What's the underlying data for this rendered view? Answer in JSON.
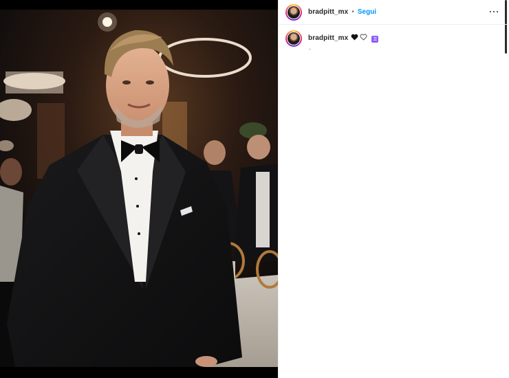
{
  "post": {
    "username": "bradpitt_mx",
    "separator": "•",
    "follow_label": "Segui",
    "more_icon": "more-horizontal-icon"
  },
  "caption": {
    "username": "bradpitt_mx",
    "emojis": [
      "black-heart",
      "white-heart",
      "purple-square-symbol"
    ],
    "emoji_box_glyph": "♊",
    "second_line": "."
  },
  "colors": {
    "link_blue": "#0095f6",
    "text": "#262626",
    "divider": "#efefef"
  }
}
